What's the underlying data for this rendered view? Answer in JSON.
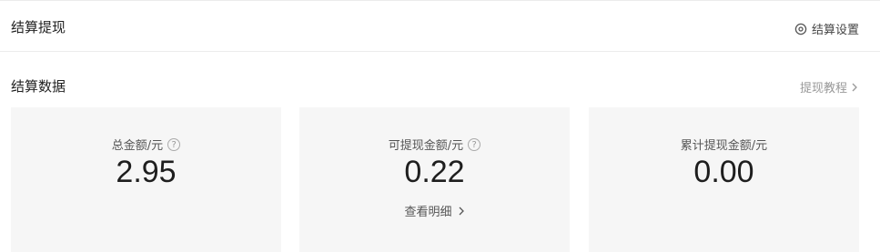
{
  "header": {
    "title": "结算提现",
    "settings_label": "结算设置",
    "settings_icon": "settings-circle-icon"
  },
  "section": {
    "title": "结算数据",
    "tutorial_label": "提现教程",
    "tutorial_icon": "chevron-right-icon"
  },
  "cards": [
    {
      "label": "总金额/元",
      "value": "2.95",
      "has_help": true
    },
    {
      "label": "可提现金额/元",
      "value": "0.22",
      "has_help": true,
      "link_label": "查看明细"
    },
    {
      "label": "累计提现金额/元",
      "value": "0.00",
      "has_help": false
    }
  ],
  "colors": {
    "card_bg": "#f6f6f6",
    "muted_text": "#999999",
    "value_text": "#1e1e1e"
  }
}
